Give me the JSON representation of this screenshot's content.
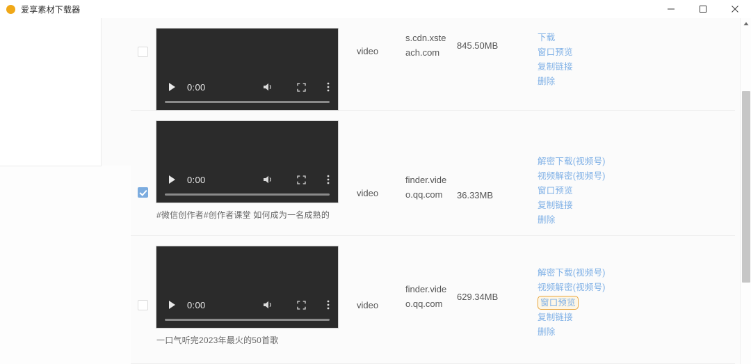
{
  "window": {
    "title": "爱享素材下载器",
    "logo_icon": "orange-circle-logo",
    "controls": {
      "minimize": "minimize-icon",
      "maximize": "maximize-icon",
      "close": "close-icon"
    }
  },
  "colors": {
    "accent_link": "#7fb0e6",
    "highlight_border": "#e9a53b",
    "highlight_fill": "#fdf6e6",
    "checkbox_checked": "#7cacdf",
    "logo": "#f0a818",
    "video_bg": "#2b2b2b",
    "page_bg": "#fbfbfb"
  },
  "player": {
    "time": "0:00",
    "play_icon": "play-icon",
    "volume_icon": "volume-icon",
    "fullscreen_icon": "fullscreen-icon",
    "more_icon": "more-vertical-icon"
  },
  "scrollbar": {
    "up_arrow_icon": "chevron-up-icon"
  },
  "rows": [
    {
      "selected": false,
      "type": "video",
      "host": "s.cdn.xsteach.com",
      "size": "845.50MB",
      "caption": "",
      "actions": [
        {
          "label": "下载",
          "highlighted": false
        },
        {
          "label": "窗口预览",
          "highlighted": false
        },
        {
          "label": "复制链接",
          "highlighted": false
        },
        {
          "label": "删除",
          "highlighted": false
        }
      ]
    },
    {
      "selected": true,
      "type": "video",
      "host": "finder.video.qq.com",
      "size": "36.33MB",
      "caption": "#微信创作者#创作者课堂 如何成为一名成熟的",
      "actions": [
        {
          "label": "解密下载(视频号)",
          "highlighted": false
        },
        {
          "label": "视频解密(视频号)",
          "highlighted": false
        },
        {
          "label": "窗口预览",
          "highlighted": false
        },
        {
          "label": "复制链接",
          "highlighted": false
        },
        {
          "label": "删除",
          "highlighted": false
        }
      ]
    },
    {
      "selected": false,
      "type": "video",
      "host": "finder.video.qq.com",
      "size": "629.34MB",
      "caption": "一口气听完2023年最火的50首歌",
      "actions": [
        {
          "label": "解密下载(视频号)",
          "highlighted": false
        },
        {
          "label": "视频解密(视频号)",
          "highlighted": false
        },
        {
          "label": "窗口预览",
          "highlighted": true
        },
        {
          "label": "复制链接",
          "highlighted": false
        },
        {
          "label": "删除",
          "highlighted": false
        }
      ]
    }
  ]
}
